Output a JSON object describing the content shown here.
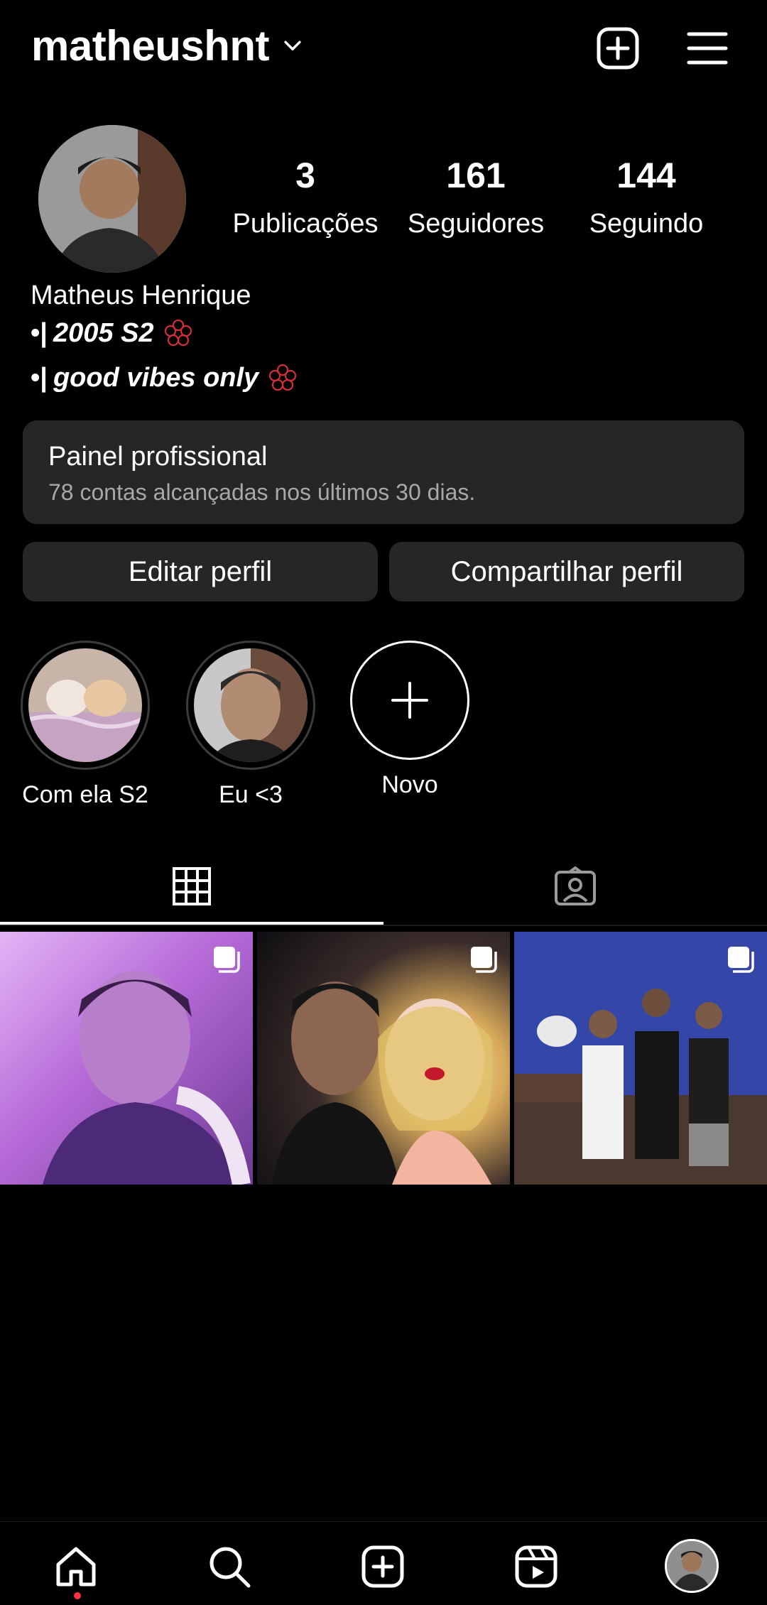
{
  "header": {
    "username": "matheushnt"
  },
  "profile": {
    "stats": [
      {
        "value": "3",
        "label": "Publicações"
      },
      {
        "value": "161",
        "label": "Seguidores"
      },
      {
        "value": "144",
        "label": "Seguindo"
      }
    ],
    "name": "Matheus Henrique",
    "bio_lines": [
      {
        "prefix": "•|",
        "text": "2005 S2"
      },
      {
        "prefix": "•|",
        "text": "good vibes only"
      }
    ]
  },
  "dashboard": {
    "title": "Painel profissional",
    "subtitle": "78 contas alcançadas nos últimos 30 dias."
  },
  "buttons": {
    "edit": "Editar perfil",
    "share": "Compartilhar perfil"
  },
  "highlights": [
    {
      "label": "Com ela S2"
    },
    {
      "label": "Eu <3"
    },
    {
      "label": "Novo"
    }
  ],
  "icons": {
    "top": [
      "chevron-down-icon",
      "create-icon",
      "menu-icon"
    ],
    "tabs": [
      "grid-icon",
      "tagged-icon"
    ],
    "nav": [
      "home-icon",
      "search-icon",
      "create-icon",
      "reels-icon",
      "profile-avatar"
    ],
    "post_badge": "multiple-posts-icon"
  },
  "colors": {
    "background": "#000000",
    "surface": "#262626",
    "muted_text": "#a8a8a8",
    "notification": "#ff3040"
  }
}
